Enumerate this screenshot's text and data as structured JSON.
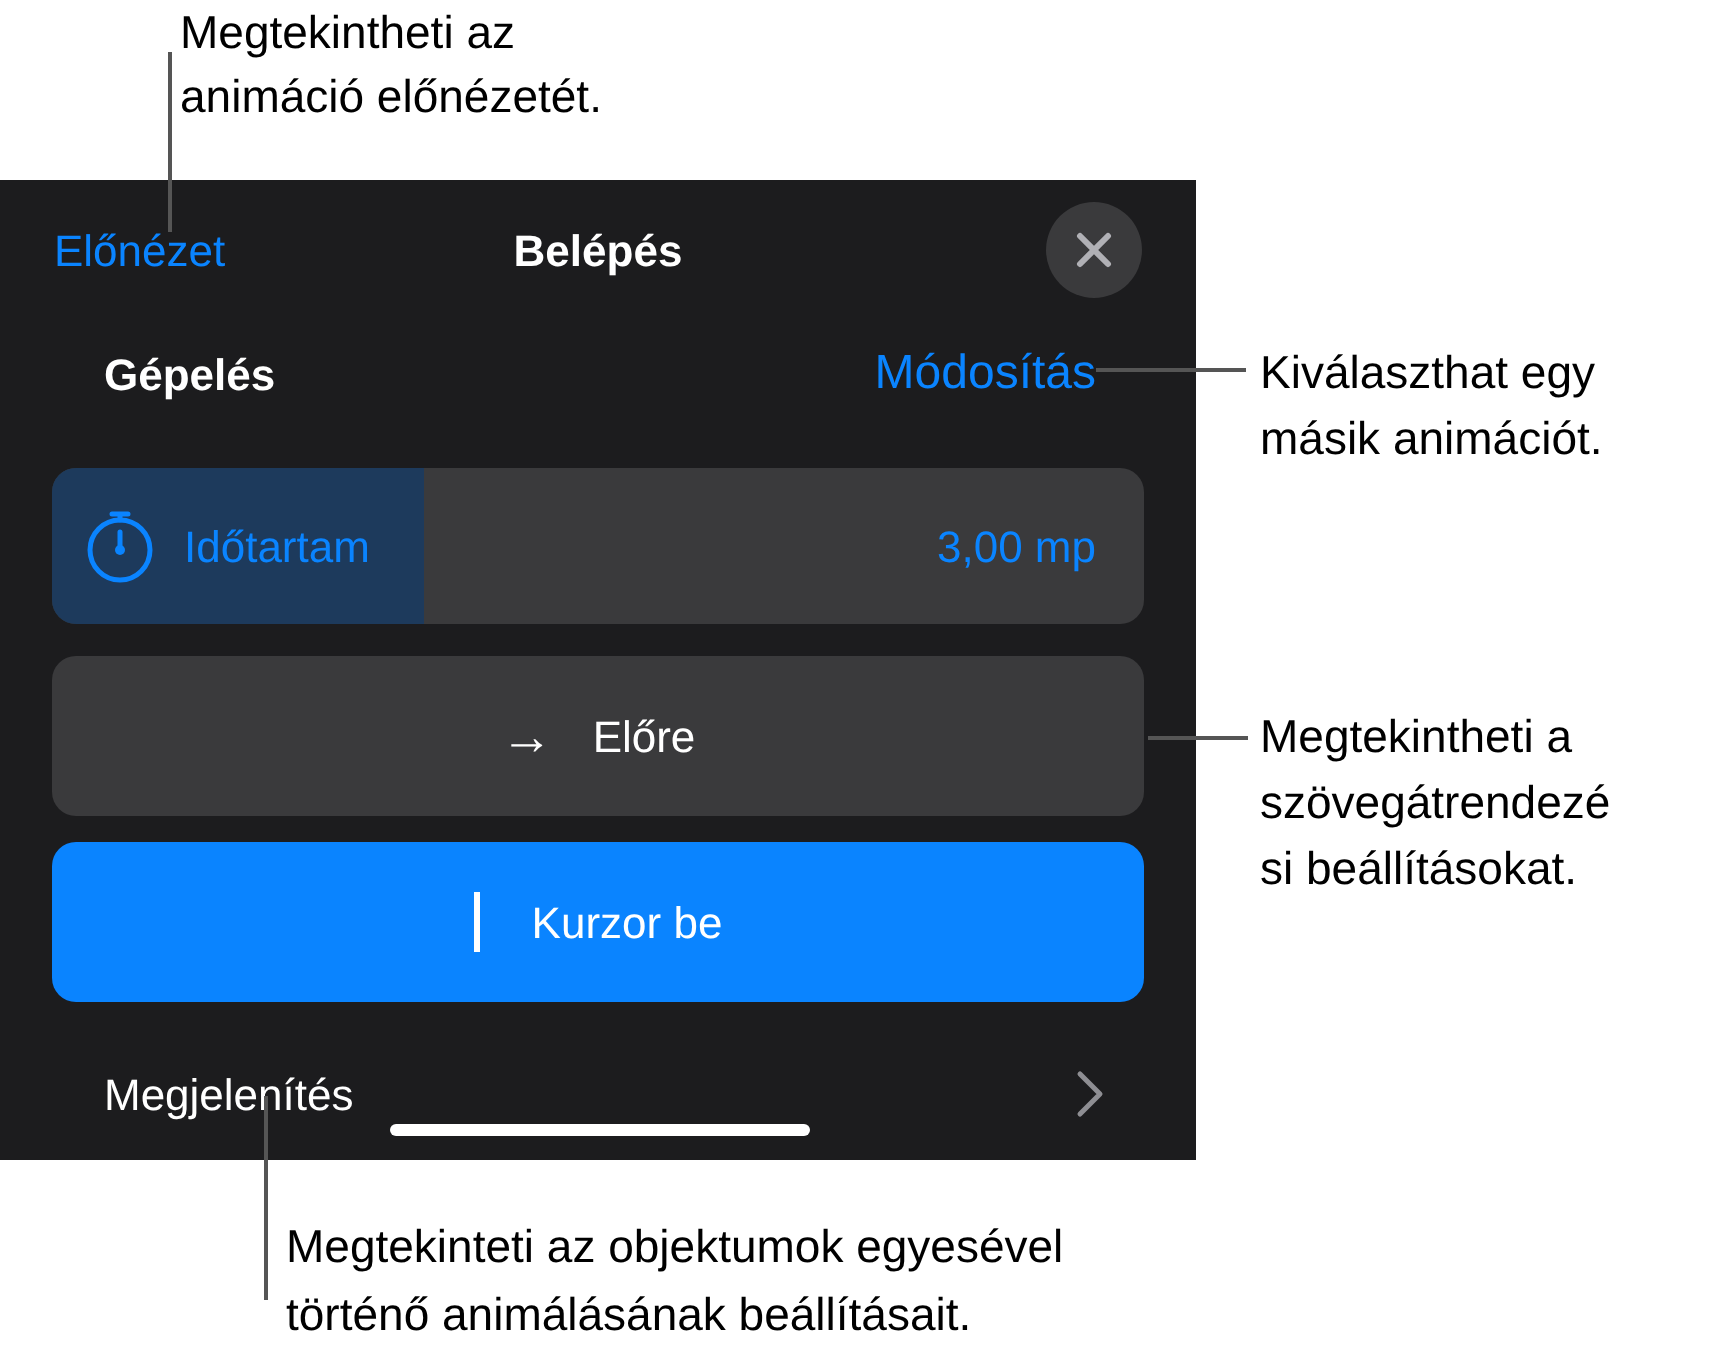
{
  "callouts": [
    {
      "lines": [
        "Megtekintheti az",
        "animáció előnézetét."
      ]
    },
    {
      "lines": [
        "Kiválaszthat egy",
        "másik animációt."
      ]
    },
    {
      "lines": [
        "Megtekintheti a",
        "szövegátrendezé",
        "si beállításokat."
      ]
    },
    {
      "lines": [
        "Megtekinteti az objektumok egyesével",
        "történő animálásának beállításait."
      ]
    }
  ],
  "panel": {
    "preview_link": "Előnézet",
    "title": "Belépés",
    "animation": {
      "name": "Gépelés",
      "change_link": "Módosítás"
    },
    "duration": {
      "label": "Időtartam",
      "reading": "3,00 mp",
      "level": 0.34
    },
    "direction_button": {
      "icon": "→",
      "label": "Előre"
    },
    "cursor_button": {
      "label": "Kurzor be",
      "on": true
    },
    "delivery_row": {
      "label": "Megjelenítés"
    }
  }
}
